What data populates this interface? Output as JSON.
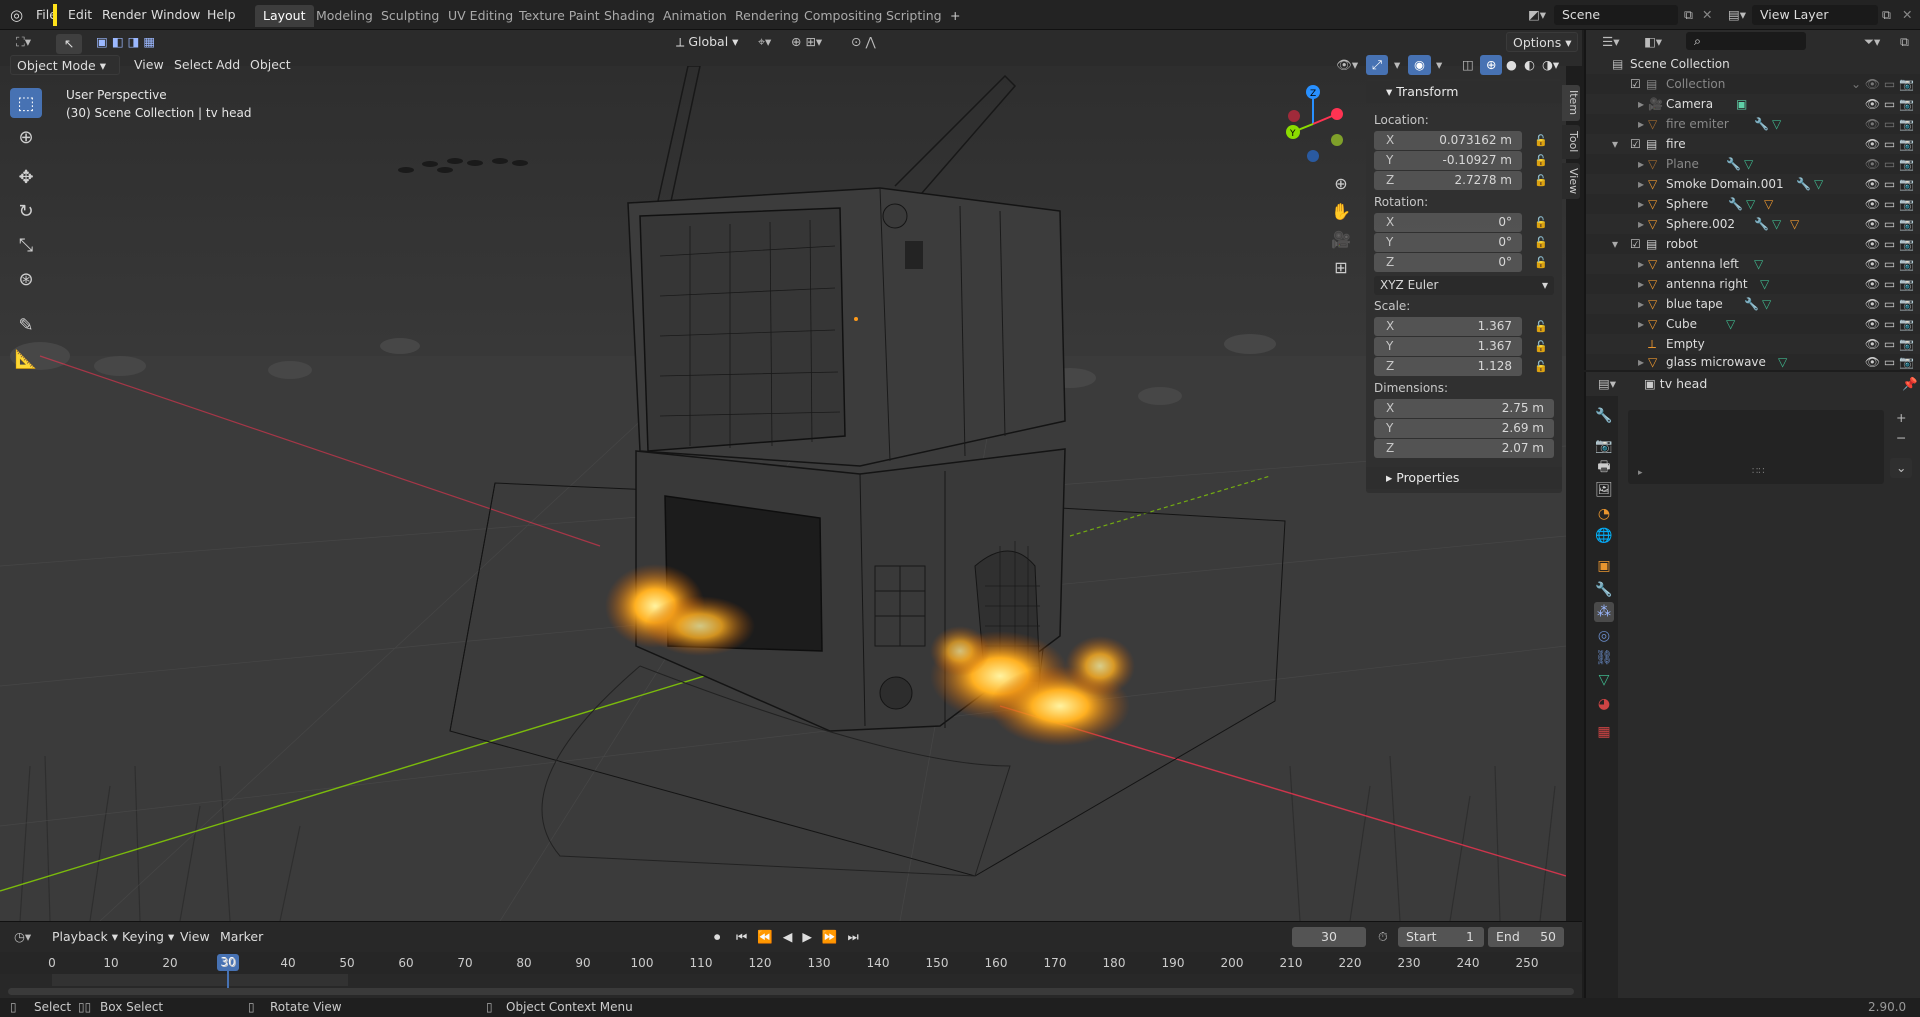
{
  "colors": {
    "accent": "#4772b3",
    "active_frame": "#4772b3",
    "axis_x": "#ff3352",
    "axis_y": "#8bdc00",
    "axis_z": "#2890ff",
    "fire": "#ffb020"
  },
  "menu": {
    "items": [
      "File",
      "Edit",
      "Render",
      "Window",
      "Help"
    ]
  },
  "workspaces": [
    "Layout",
    "Modeling",
    "Sculpting",
    "UV Editing",
    "Texture Paint",
    "Shading",
    "Animation",
    "Rendering",
    "Compositing",
    "Scripting",
    "+"
  ],
  "scene": {
    "name": "Scene",
    "view_layer": "View Layer"
  },
  "header": {
    "mode": "Object Mode",
    "view": "View",
    "select": "Select",
    "add": "Add",
    "object": "Object",
    "orientation": "Global",
    "options": "Options"
  },
  "viewport": {
    "perspective": "User Perspective",
    "context": "(30) Scene Collection | tv head"
  },
  "npanel": {
    "transform_title": "Transform",
    "location_label": "Location:",
    "location": {
      "x": "0.073162 m",
      "y": "-0.10927 m",
      "z": "2.7278 m"
    },
    "rotation_label": "Rotation:",
    "rotation": {
      "x": "0°",
      "y": "0°",
      "z": "0°"
    },
    "rotation_mode": "XYZ Euler",
    "scale_label": "Scale:",
    "scale": {
      "x": "1.367",
      "y": "1.367",
      "z": "1.128"
    },
    "dimensions_label": "Dimensions:",
    "dimensions": {
      "x": "2.75 m",
      "y": "2.69 m",
      "z": "2.07 m"
    },
    "properties_title": "Properties",
    "axis": {
      "x": "X",
      "y": "Y",
      "z": "Z"
    }
  },
  "side_tabs": [
    "Item",
    "Tool",
    "View"
  ],
  "outliner": {
    "root": "Scene Collection",
    "rows": [
      "Collection",
      "Camera",
      "fire emiter",
      "fire",
      "Plane",
      "Smoke Domain.001",
      "Sphere",
      "Sphere.002",
      "robot",
      "antenna left",
      "antenna right",
      "blue tape",
      "Cube",
      "Empty",
      "glass microwave"
    ]
  },
  "properties": {
    "object_name": "tv head"
  },
  "timeline": {
    "playback": "Playback",
    "keying": "Keying",
    "view": "View",
    "marker": "Marker",
    "current_frame": "30",
    "start_label": "Start",
    "start": "1",
    "end_label": "End",
    "end": "50",
    "ticks": [
      "0",
      "10",
      "20",
      "30",
      "40",
      "50",
      "60",
      "70",
      "80",
      "90",
      "100",
      "110",
      "120",
      "130",
      "140",
      "150",
      "160",
      "170",
      "180",
      "190",
      "200",
      "210",
      "220",
      "230",
      "240",
      "250"
    ]
  },
  "status": {
    "select": "Select",
    "box_select": "Box Select",
    "rotate_view": "Rotate View",
    "context_menu": "Object Context Menu",
    "version": "2.90.0"
  }
}
